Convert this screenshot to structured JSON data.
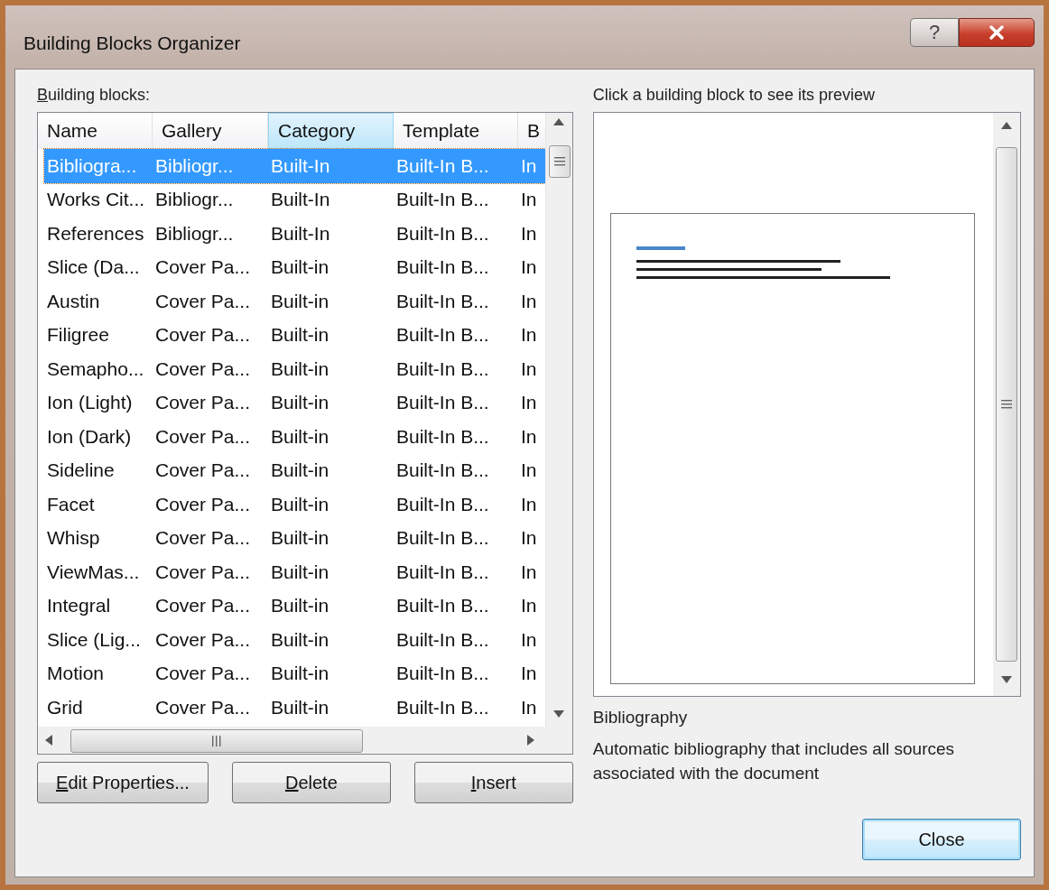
{
  "window": {
    "title": "Building Blocks Organizer",
    "help_button": "?"
  },
  "list": {
    "label": "Building blocks:",
    "columns": [
      {
        "label": "Name",
        "sorted": false
      },
      {
        "label": "Gallery",
        "sorted": false
      },
      {
        "label": "Category",
        "sorted": true
      },
      {
        "label": "Template",
        "sorted": false
      },
      {
        "label": "B",
        "sorted": false
      }
    ],
    "rows": [
      {
        "cells": [
          "Bibliogra...",
          "Bibliogr...",
          "Built-In",
          "Built-In B...",
          "In"
        ],
        "selected": true
      },
      {
        "cells": [
          "Works Cit...",
          "Bibliogr...",
          "Built-In",
          "Built-In B...",
          "In"
        ],
        "selected": false
      },
      {
        "cells": [
          "References",
          "Bibliogr...",
          "Built-In",
          "Built-In B...",
          "In"
        ],
        "selected": false
      },
      {
        "cells": [
          "Slice (Da...",
          "Cover Pa...",
          "Built-in",
          "Built-In B...",
          "In"
        ],
        "selected": false
      },
      {
        "cells": [
          "Austin",
          "Cover Pa...",
          "Built-in",
          "Built-In B...",
          "In"
        ],
        "selected": false
      },
      {
        "cells": [
          "Filigree",
          "Cover Pa...",
          "Built-in",
          "Built-In B...",
          "In"
        ],
        "selected": false
      },
      {
        "cells": [
          "Semapho...",
          "Cover Pa...",
          "Built-in",
          "Built-In B...",
          "In"
        ],
        "selected": false
      },
      {
        "cells": [
          "Ion (Light)",
          "Cover Pa...",
          "Built-in",
          "Built-In B...",
          "In"
        ],
        "selected": false
      },
      {
        "cells": [
          "Ion (Dark)",
          "Cover Pa...",
          "Built-in",
          "Built-In B...",
          "In"
        ],
        "selected": false
      },
      {
        "cells": [
          "Sideline",
          "Cover Pa...",
          "Built-in",
          "Built-In B...",
          "In"
        ],
        "selected": false
      },
      {
        "cells": [
          "Facet",
          "Cover Pa...",
          "Built-in",
          "Built-In B...",
          "In"
        ],
        "selected": false
      },
      {
        "cells": [
          "Whisp",
          "Cover Pa...",
          "Built-in",
          "Built-In B...",
          "In"
        ],
        "selected": false
      },
      {
        "cells": [
          "ViewMas...",
          "Cover Pa...",
          "Built-in",
          "Built-In B...",
          "In"
        ],
        "selected": false
      },
      {
        "cells": [
          "Integral",
          "Cover Pa...",
          "Built-in",
          "Built-In B...",
          "In"
        ],
        "selected": false
      },
      {
        "cells": [
          "Slice (Lig...",
          "Cover Pa...",
          "Built-in",
          "Built-In B...",
          "In"
        ],
        "selected": false
      },
      {
        "cells": [
          "Motion",
          "Cover Pa...",
          "Built-in",
          "Built-In B...",
          "In"
        ],
        "selected": false
      },
      {
        "cells": [
          "Grid",
          "Cover Pa...",
          "Built-in",
          "Built-In B...",
          "In"
        ],
        "selected": false
      }
    ],
    "buttons": [
      "Edit Properties...",
      "Delete",
      "Insert"
    ]
  },
  "preview": {
    "label": "Click a building block to see its preview",
    "name": "Bibliography",
    "description": "Automatic bibliography that includes all sources associated with the document"
  },
  "close_button": "Close"
}
